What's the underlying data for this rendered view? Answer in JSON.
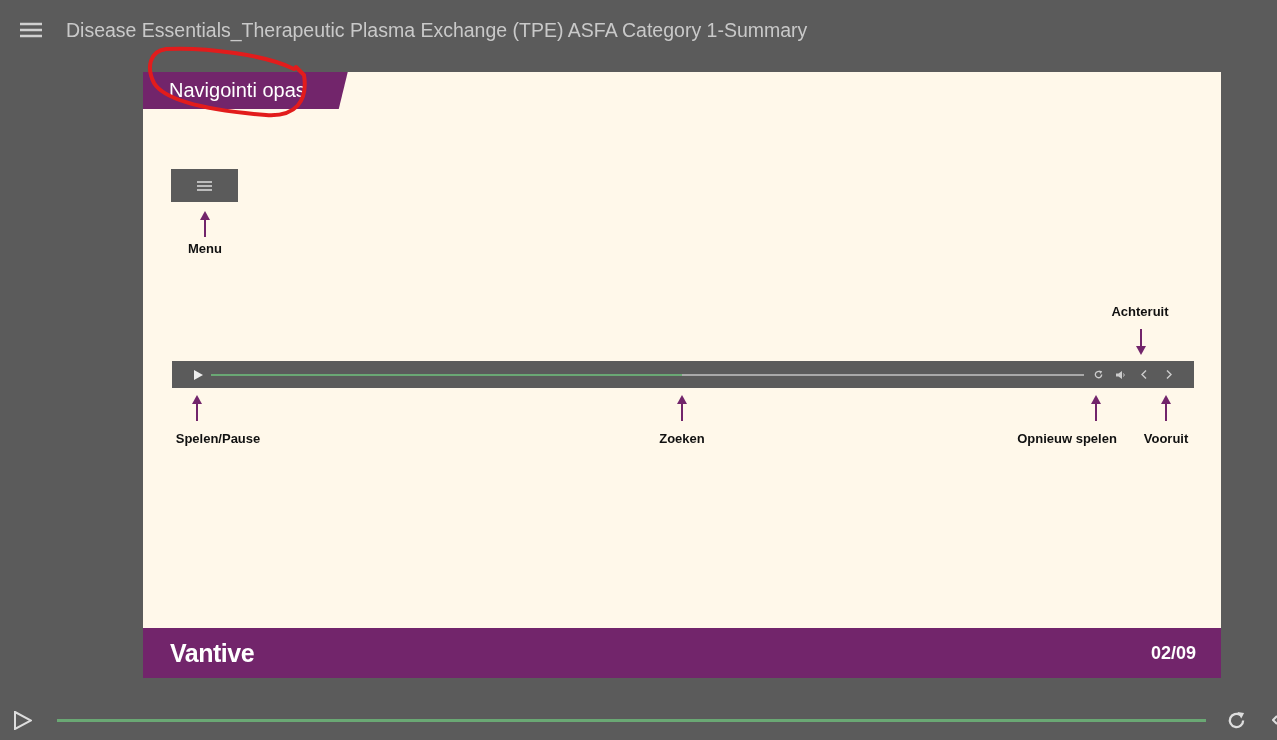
{
  "header": {
    "title": "Disease Essentials_Therapeutic Plasma Exchange (TPE) ASFA Category 1-Summary"
  },
  "slide": {
    "title": "Navigointi opas",
    "menu_label": "Menu",
    "player": {
      "level": 0.54
    },
    "callouts": [
      {
        "kind": "up",
        "label": "Spelen/Pause"
      },
      {
        "kind": "up",
        "label": "Zoeken"
      },
      {
        "kind": "up",
        "label": "Opnieuw spelen"
      },
      {
        "kind": "down",
        "label": "Achteruit"
      },
      {
        "kind": "up",
        "label": "Vooruit"
      }
    ],
    "logo": "Vantive",
    "page": "02/09"
  },
  "player": {
    "level": 1
  }
}
